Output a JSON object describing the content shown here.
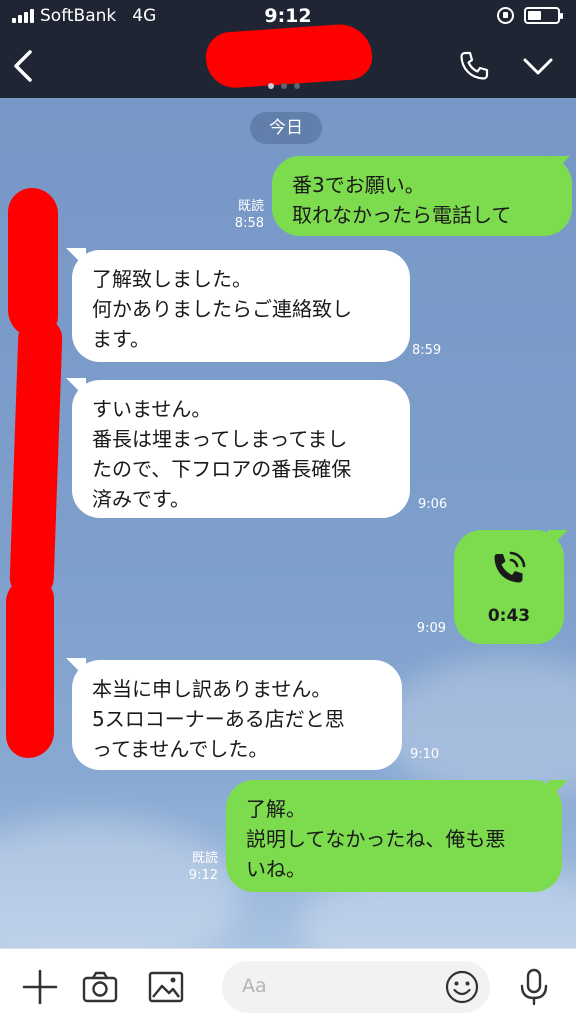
{
  "status_bar": {
    "carrier": "SoftBank",
    "network": "4G",
    "time": "9:12"
  },
  "header": {
    "back_icon": "chevron-left-icon",
    "call_icon": "phone-icon",
    "menu_icon": "chevron-down-icon"
  },
  "chat": {
    "date_label": "今日",
    "messages": [
      {
        "dir": "out",
        "text": "番3でお願い。\n取れなかったら電話して",
        "read": "既読",
        "time": "8:58"
      },
      {
        "dir": "in",
        "text": "了解致しました。\n何かありましたらご連絡致し\nます。",
        "time": "8:59"
      },
      {
        "dir": "in",
        "text": "すいません。\n番長は埋まってしまってまし\nたので、下フロアの番長確保\n済みです。",
        "time": "9:06"
      },
      {
        "dir": "out",
        "type": "call",
        "duration": "0:43",
        "time": "9:09"
      },
      {
        "dir": "in",
        "text": "本当に申し訳ありません。\n5スロコーナーある店だと思\nってませんでした。",
        "time": "9:10"
      },
      {
        "dir": "out",
        "text": "了解。\n説明してなかったね、俺も悪\nいね。",
        "read": "既読",
        "time": "9:12"
      }
    ]
  },
  "footer": {
    "input_placeholder": "Aa",
    "icons": [
      "plus-icon",
      "camera-icon",
      "image-icon",
      "emoji-icon",
      "microphone-icon"
    ]
  }
}
